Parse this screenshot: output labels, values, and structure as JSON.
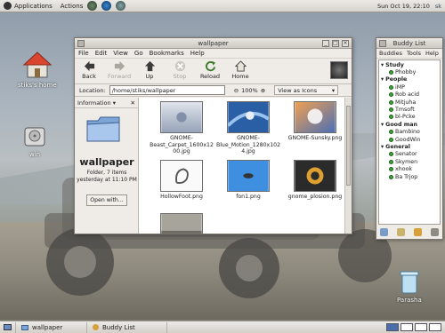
{
  "top_panel": {
    "menus": [
      "Applications",
      "Actions"
    ],
    "clock": "Sun Oct 19, 22:10",
    "user_indicator": "sk"
  },
  "desktop": {
    "icons": [
      {
        "label": "stiks's home",
        "icon": "home-folder-icon"
      },
      {
        "label": "win",
        "icon": "drive-icon"
      },
      {
        "label": "Parasha",
        "icon": "trash-icon"
      }
    ]
  },
  "nautilus": {
    "title": "wallpaper",
    "menu": [
      "File",
      "Edit",
      "View",
      "Go",
      "Bookmarks",
      "Help"
    ],
    "toolbar": [
      {
        "label": "Back",
        "icon": "back-arrow-icon",
        "enabled": true
      },
      {
        "label": "Forward",
        "icon": "forward-arrow-icon",
        "enabled": false
      },
      {
        "label": "Up",
        "icon": "up-arrow-icon",
        "enabled": true
      },
      {
        "label": "Stop",
        "icon": "stop-icon",
        "enabled": false
      },
      {
        "label": "Reload",
        "icon": "reload-icon",
        "enabled": true
      },
      {
        "label": "Home",
        "icon": "home-icon",
        "enabled": true
      }
    ],
    "location_label": "Location:",
    "location_value": "/home/stiks/wallpaper",
    "zoom": "100%",
    "view_mode": "View as Icons",
    "sidebar": {
      "header": "Information",
      "folder_name": "wallpaper",
      "info_line1": "Folder, 7 items",
      "info_line2": "yesterday at 11:10 PM",
      "open_with": "Open with..."
    },
    "files": [
      {
        "name": "GNOME-Beast_Carpet_1600x1200.jpg",
        "line1": "GNOME-",
        "line2": "Beast_Carpet_1600x12",
        "line3": "00.jpg"
      },
      {
        "name": "GNOME-Blue_Motion_1280x1024.jpg",
        "line1": "GNOME-",
        "line2": "Blue_Motion_1280x102",
        "line3": "4.jpg"
      },
      {
        "name": "GNOME-Sunsky.png",
        "line1": "GNOME-Sunsky.png",
        "line2": "",
        "line3": ""
      },
      {
        "name": "HollowFoot.png",
        "line1": "HollowFoot.png",
        "line2": "",
        "line3": ""
      },
      {
        "name": "fon1.png",
        "line1": "fon1.png",
        "line2": "",
        "line3": ""
      },
      {
        "name": "gnome_plosion.png",
        "line1": "gnome_plosion.png",
        "line2": "",
        "line3": ""
      },
      {
        "name": "",
        "line1": "",
        "line2": "",
        "line3": ""
      }
    ]
  },
  "buddy_list": {
    "title": "Buddy List",
    "menu": [
      "Buddies",
      "Tools",
      "Help"
    ],
    "groups": [
      {
        "name": "Study",
        "buddies": [
          "Phobby"
        ]
      },
      {
        "name": "People",
        "buddies": [
          "iMP",
          "Rob acid",
          "Mitjuha",
          "Tmsoft",
          "bl-Pcke"
        ]
      },
      {
        "name": "Good man",
        "buddies": [
          "Bambino",
          "GoodWin"
        ]
      },
      {
        "name": "General",
        "buddies": [
          "Senator",
          "Skymen",
          "xhook",
          "Ba Trjop"
        ]
      }
    ]
  },
  "taskbar": {
    "tasks": [
      {
        "label": "wallpaper",
        "icon": "folder-icon"
      },
      {
        "label": "Buddy List",
        "icon": "chat-icon"
      }
    ],
    "workspaces": 4,
    "active_workspace": 1
  },
  "colors": {
    "selection_blue": "#4a6ea9",
    "online_green": "#3fa33a"
  }
}
